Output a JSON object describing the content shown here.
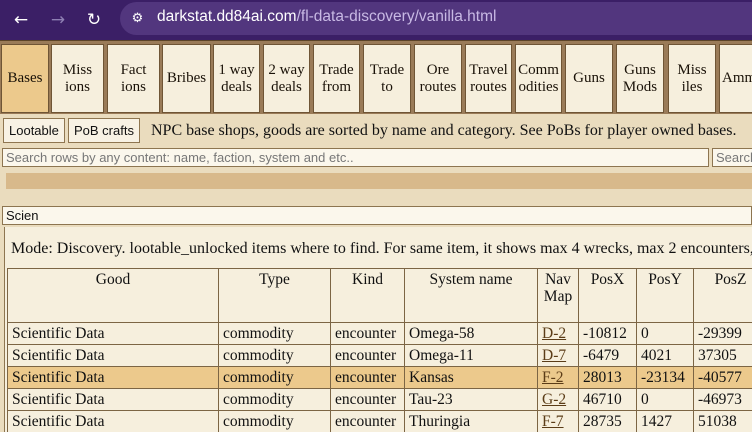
{
  "browser": {
    "url_host": "darkstat.dd84ai.com",
    "url_path": "/fl-data-discovery/vanilla.html"
  },
  "tabs": [
    {
      "label": "Bases",
      "active": true
    },
    {
      "label": "Miss\nions"
    },
    {
      "label": "Fact\nions"
    },
    {
      "label": "Bribes"
    },
    {
      "label": "1 way\ndeals"
    },
    {
      "label": "2 way\ndeals"
    },
    {
      "label": "Trade\nfrom"
    },
    {
      "label": "Trade\nto"
    },
    {
      "label": "Ore\nroutes"
    },
    {
      "label": "Travel\nroutes"
    },
    {
      "label": "Comm\nodities"
    },
    {
      "label": "Guns"
    },
    {
      "label": "Guns\nMods"
    },
    {
      "label": "Miss\niles"
    },
    {
      "label": "Amm"
    }
  ],
  "subbar": {
    "lootable_label": "Lootable",
    "pob_label": "PoB crafts",
    "description": "NPC base shops, goods are sorted by name and category. See PoBs for player owned bases."
  },
  "search": {
    "main_placeholder": "Search rows by any content: name, faction, system and etc..",
    "second_placeholder": "Search"
  },
  "filter": {
    "value": "Scien"
  },
  "mode_text": "Mode: Discovery. lootable_unlocked items where to find. For same item, it shows max 4 wrecks, max 2 encounters,",
  "table": {
    "headers": [
      "Good",
      "Type",
      "Kind",
      "System name",
      "Nav\nMap",
      "PosX",
      "PosY",
      "PosZ"
    ],
    "rows": [
      [
        "Scientific Data",
        "commodity",
        "encounter",
        "Omega-58",
        "D-2",
        "-10812",
        "0",
        "-29399"
      ],
      [
        "Scientific Data",
        "commodity",
        "encounter",
        "Omega-11",
        "D-7",
        "-6479",
        "4021",
        "37305"
      ],
      [
        "Scientific Data",
        "commodity",
        "encounter",
        "Kansas",
        "F-2",
        "28013",
        "-23134",
        "-40577"
      ],
      [
        "Scientific Data",
        "commodity",
        "encounter",
        "Tau-23",
        "G-2",
        "46710",
        "0",
        "-46973"
      ],
      [
        "Scientific Data",
        "commodity",
        "encounter",
        "Thuringia",
        "F-7",
        "28735",
        "1427",
        "51038"
      ]
    ],
    "selected_row": 2
  }
}
